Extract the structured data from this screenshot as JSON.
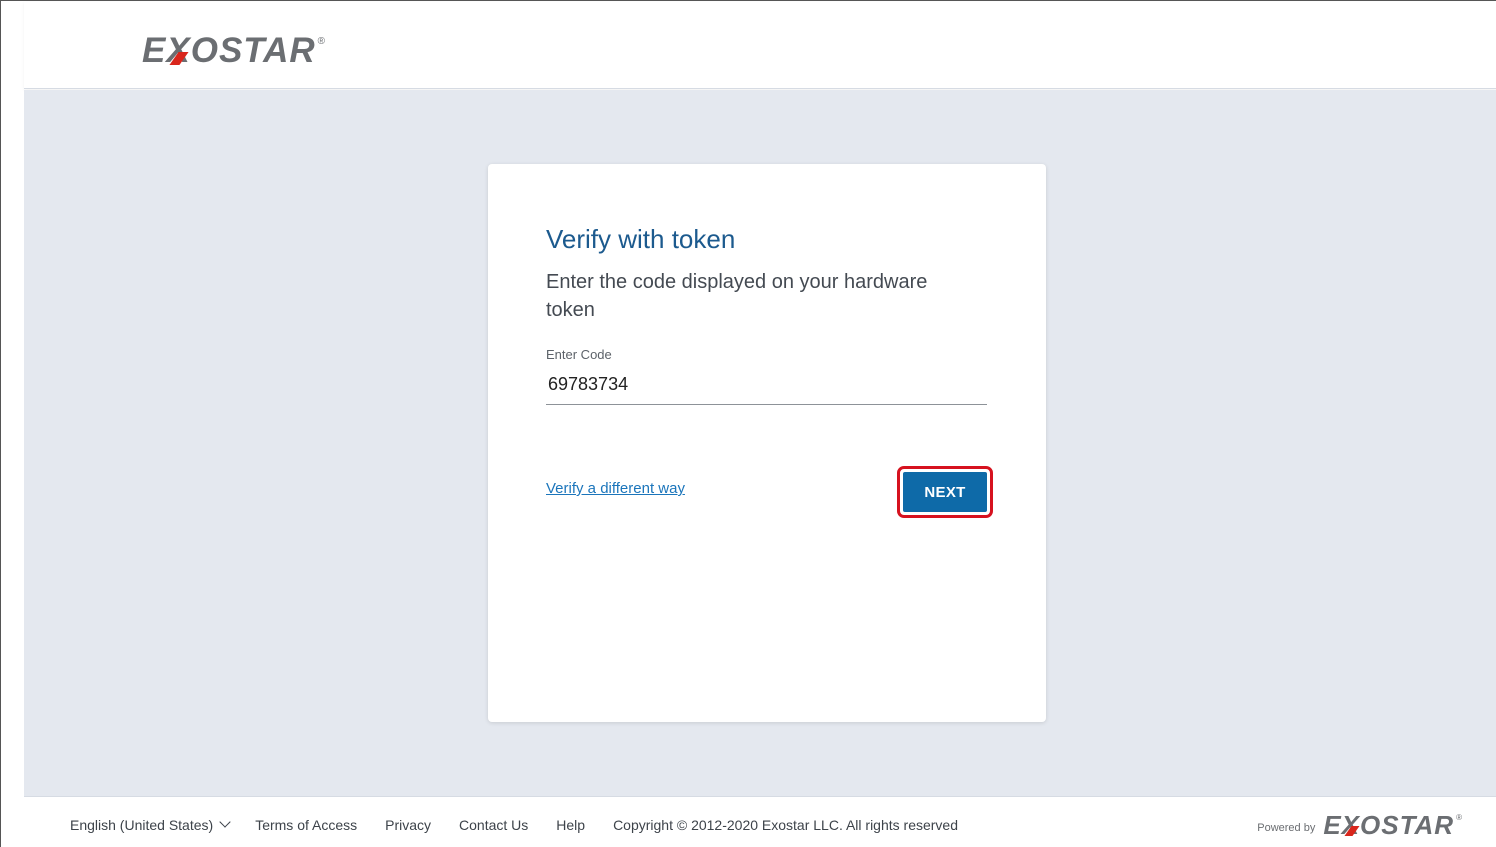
{
  "header": {
    "logo": {
      "first": "E",
      "x": "X",
      "rest": "OSTAR",
      "reg": "®"
    }
  },
  "card": {
    "title": "Verify with token",
    "subtitle": "Enter the code displayed on your hardware token",
    "field": {
      "label": "Enter Code",
      "value": "69783734"
    },
    "alt_link": "Verify a different way",
    "next_label": "NEXT"
  },
  "footer": {
    "language": "English (United States)",
    "links": [
      "Terms of Access",
      "Privacy",
      "Contact Us",
      "Help"
    ],
    "copyright": "Copyright © 2012-2020 Exostar LLC. All rights reserved",
    "powered_by": "Powered by",
    "logo": {
      "first": "E",
      "x": "X",
      "rest": "OSTAR",
      "reg": "®"
    }
  },
  "colors": {
    "title": "#1c5a8e",
    "button": "#0e6aa8",
    "link": "#1b75bb",
    "background": "#e4e8ef",
    "highlight": "#d6121f",
    "logo_gray": "#6b6e72",
    "logo_red": "#d9261c"
  },
  "icons": {
    "language_dropdown": "chevron-down-icon"
  }
}
